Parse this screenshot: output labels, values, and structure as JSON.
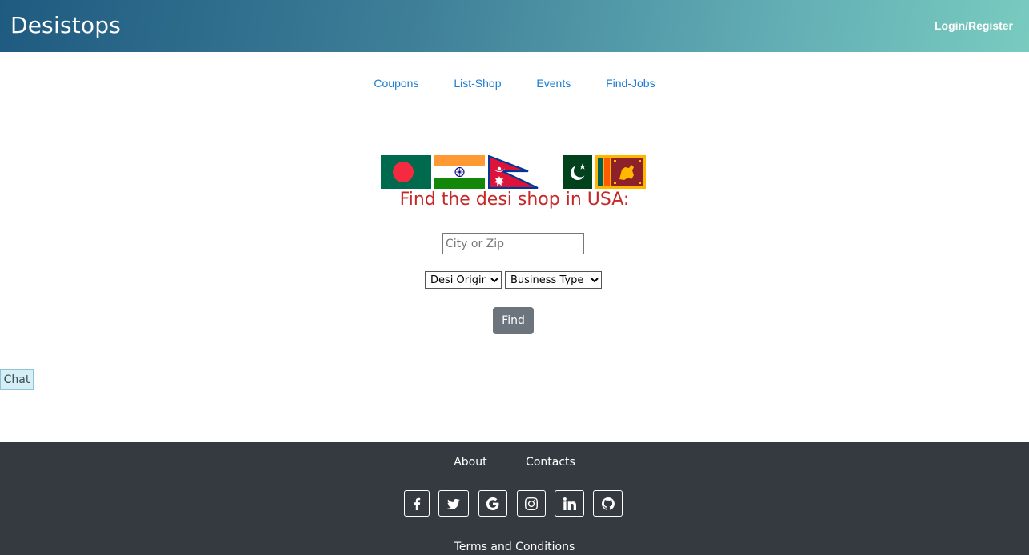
{
  "header": {
    "brand": "Desistops",
    "login_label": "Login/Register",
    "gradient": [
      "#1f5a80",
      "#79cbc0"
    ]
  },
  "nav": {
    "items": [
      {
        "label": "Coupons"
      },
      {
        "label": "List-Shop"
      },
      {
        "label": "Events"
      },
      {
        "label": "Find-Jobs"
      }
    ],
    "link_color": "#1a7bd0"
  },
  "flags": [
    "bangladesh-flag",
    "india-flag",
    "nepal-flag",
    "pakistan-flag",
    "sri-lanka-flag"
  ],
  "search": {
    "headline": "Find the desi shop in USA:",
    "headline_color": "#c62828",
    "city_placeholder": "City or Zip",
    "city_value": "",
    "origin_selected": "Desi Origin",
    "business_selected": "Business Type",
    "find_label": "Find"
  },
  "chat": {
    "label": "Chat"
  },
  "footer": {
    "links": [
      {
        "label": "About"
      },
      {
        "label": "Contacts"
      }
    ],
    "social_icons": [
      "facebook-icon",
      "twitter-icon",
      "google-icon",
      "instagram-icon",
      "linkedin-icon",
      "github-icon"
    ],
    "terms_label": "Terms and Conditions",
    "background": "#343a40"
  }
}
